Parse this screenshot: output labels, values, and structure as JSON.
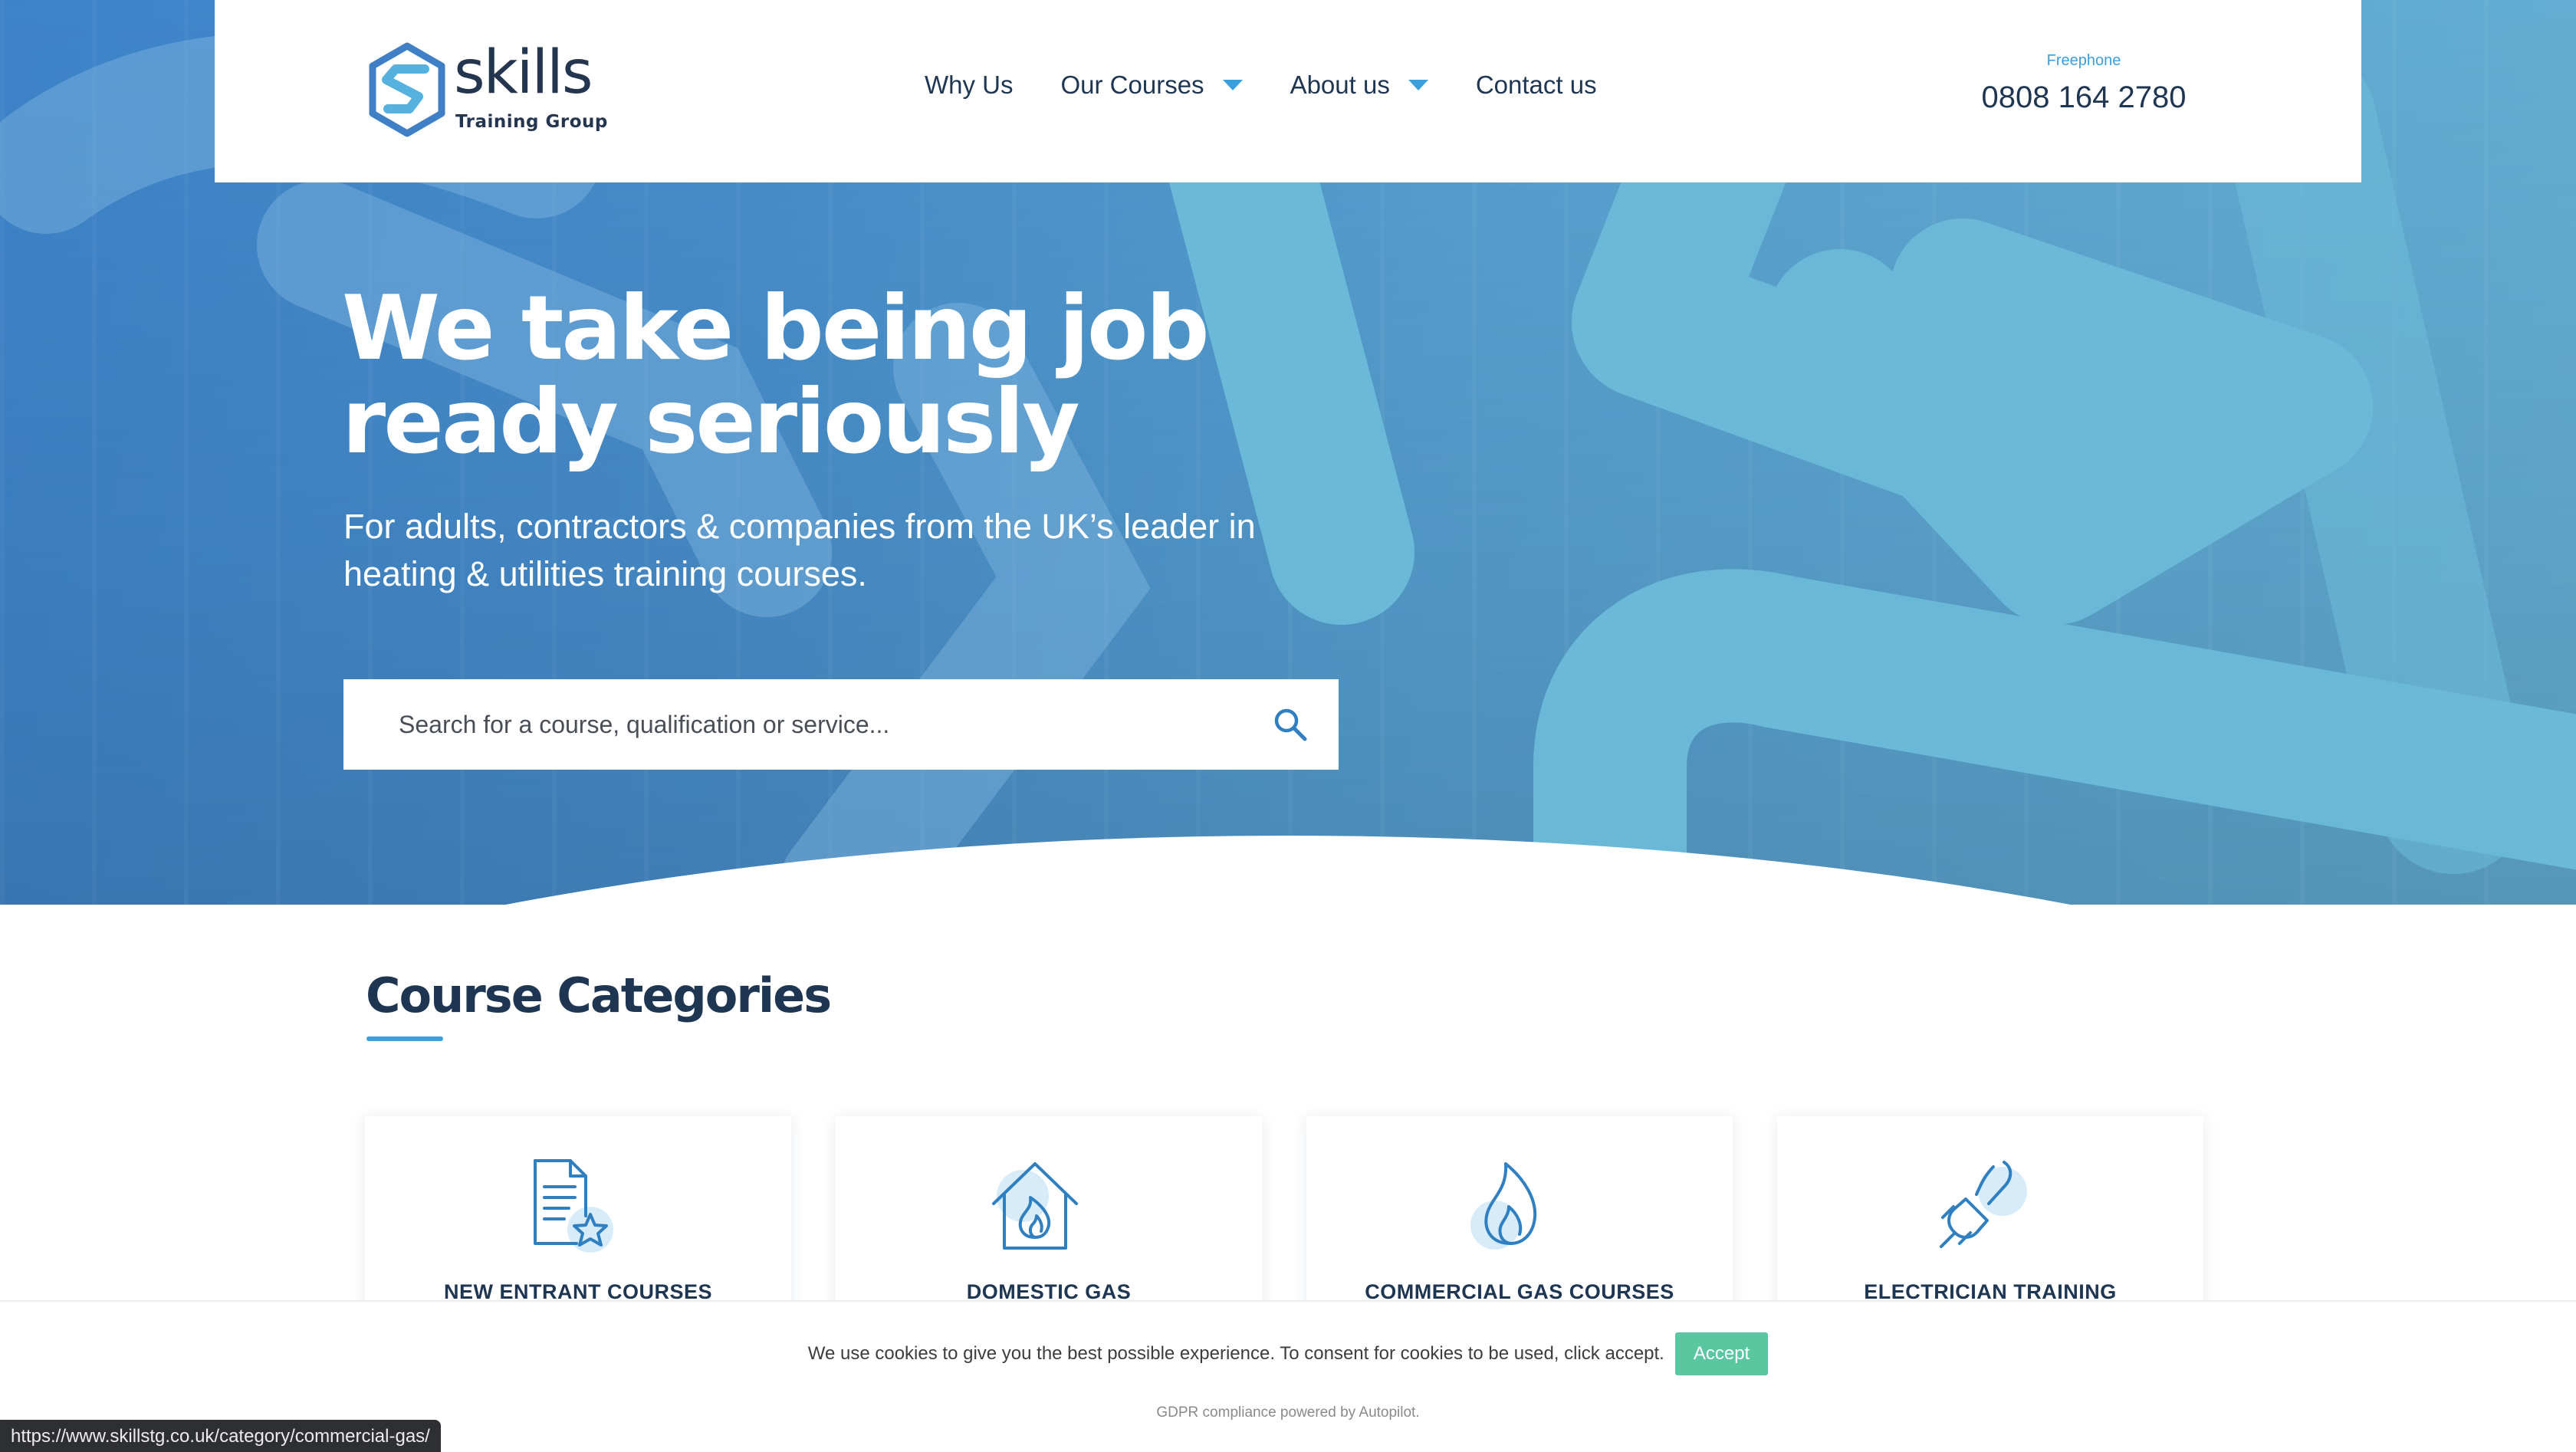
{
  "header": {
    "logo": {
      "word": "skills",
      "subtitle": "Training Group"
    },
    "nav": [
      {
        "label": "Why Us",
        "dropdown": false
      },
      {
        "label": "Our Courses",
        "dropdown": true
      },
      {
        "label": "About us",
        "dropdown": true
      },
      {
        "label": "Contact us",
        "dropdown": false
      }
    ],
    "phone": {
      "label": "Freephone",
      "number": "0808 164 2780"
    }
  },
  "hero": {
    "title": "We take being job ready seriously",
    "subtitle": "For adults, contractors & companies from the UK’s leader in heating & utilities training courses.",
    "search": {
      "placeholder": "Search for a course, qualification or service...",
      "value": "",
      "icon": "search-icon"
    }
  },
  "categories": {
    "title": "Course Categories",
    "items": [
      {
        "label": "NEW ENTRANT COURSES",
        "icon": "document-star-icon"
      },
      {
        "label": "DOMESTIC GAS",
        "icon": "house-flame-icon"
      },
      {
        "label": "COMMERCIAL GAS COURSES",
        "icon": "flame-icon"
      },
      {
        "label": "ELECTRICIAN TRAINING",
        "icon": "plug-icon"
      }
    ]
  },
  "cookie": {
    "text": "We use cookies to give you the best possible experience. To consent for cookies to be used, click accept.",
    "accept_label": "Accept",
    "footer": "GDPR compliance powered by Autopilot."
  },
  "status_bar": {
    "url": "https://www.skillstg.co.uk/category/commercial-gas/"
  },
  "colors": {
    "accent": "#3b9fdc",
    "navy": "#1f3653",
    "accept": "#5bc7a1",
    "hero_blue": "#4a93d1",
    "swoosh": "#6cbad9"
  }
}
